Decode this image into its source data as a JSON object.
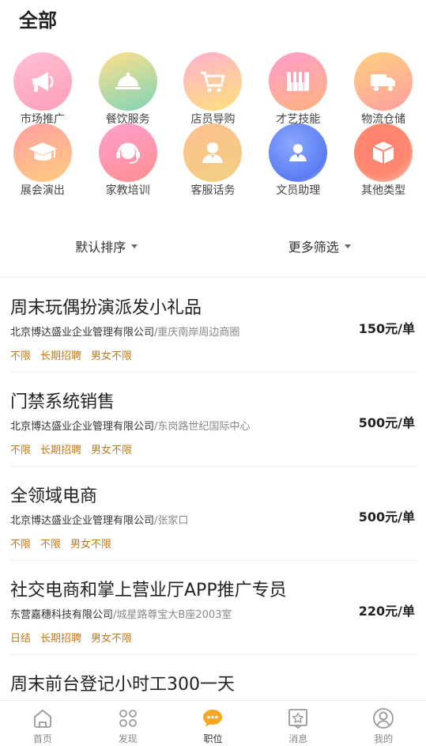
{
  "page": {
    "title": "全部"
  },
  "categories": [
    {
      "label": "市场推广",
      "icon": "megaphone-icon"
    },
    {
      "label": "餐饮服务",
      "icon": "food-cloche-icon"
    },
    {
      "label": "店员导购",
      "icon": "shopping-cart-icon"
    },
    {
      "label": "才艺技能",
      "icon": "piano-icon"
    },
    {
      "label": "物流仓储",
      "icon": "delivery-truck-icon"
    },
    {
      "label": "展会演出",
      "icon": "graduation-cap-icon"
    },
    {
      "label": "家教培训",
      "icon": "headset-icon"
    },
    {
      "label": "客服话务",
      "icon": "customer-service-icon"
    },
    {
      "label": "文员助理",
      "icon": "clerk-icon"
    },
    {
      "label": "其他类型",
      "icon": "box-icon"
    }
  ],
  "filters": {
    "sort_label": "默认排序",
    "more_label": "更多筛选"
  },
  "jobs": [
    {
      "title": "周末玩偶扮演派发小礼品",
      "company": "北京博达盛业企业管理有限公司",
      "separator": "/",
      "address": "重庆南岸周边商圈",
      "tags": [
        "不限",
        "长期招聘",
        "男女不限"
      ],
      "price": "150元/单"
    },
    {
      "title": "门禁系统销售",
      "company": "北京博达盛业企业管理有限公司",
      "separator": "/",
      "address": "东岗路世纪国际中心",
      "tags": [
        "不限",
        "长期招聘",
        "男女不限"
      ],
      "price": "500元/单"
    },
    {
      "title": "全领域电商",
      "company": "北京博达盛业企业管理有限公司",
      "separator": "/",
      "address": "张家口",
      "tags": [
        "不限",
        "不限",
        "男女不限"
      ],
      "price": "500元/单"
    },
    {
      "title": "社交电商和掌上营业厅APP推广专员",
      "company": "东营嘉穗科技有限公司",
      "separator": "/",
      "address": "城星路尊宝大B座2003室",
      "tags": [
        "日结",
        "长期招聘",
        "男女不限"
      ],
      "price": "220元/单"
    },
    {
      "title": "周末前台登记小时工300一天",
      "company": "",
      "separator": "",
      "address": "",
      "tags": [],
      "price": ""
    }
  ],
  "tabbar": {
    "items": [
      {
        "label": "首页",
        "icon": "home-icon",
        "active": false
      },
      {
        "label": "发现",
        "icon": "discover-icon",
        "active": false
      },
      {
        "label": "职位",
        "icon": "chat-bubble-icon",
        "active": true
      },
      {
        "label": "消息",
        "icon": "star-message-icon",
        "active": false
      },
      {
        "label": "我的",
        "icon": "profile-icon",
        "active": false
      }
    ]
  },
  "colors": {
    "tag": "#c17a1a",
    "active_tab": "#f5a623"
  }
}
